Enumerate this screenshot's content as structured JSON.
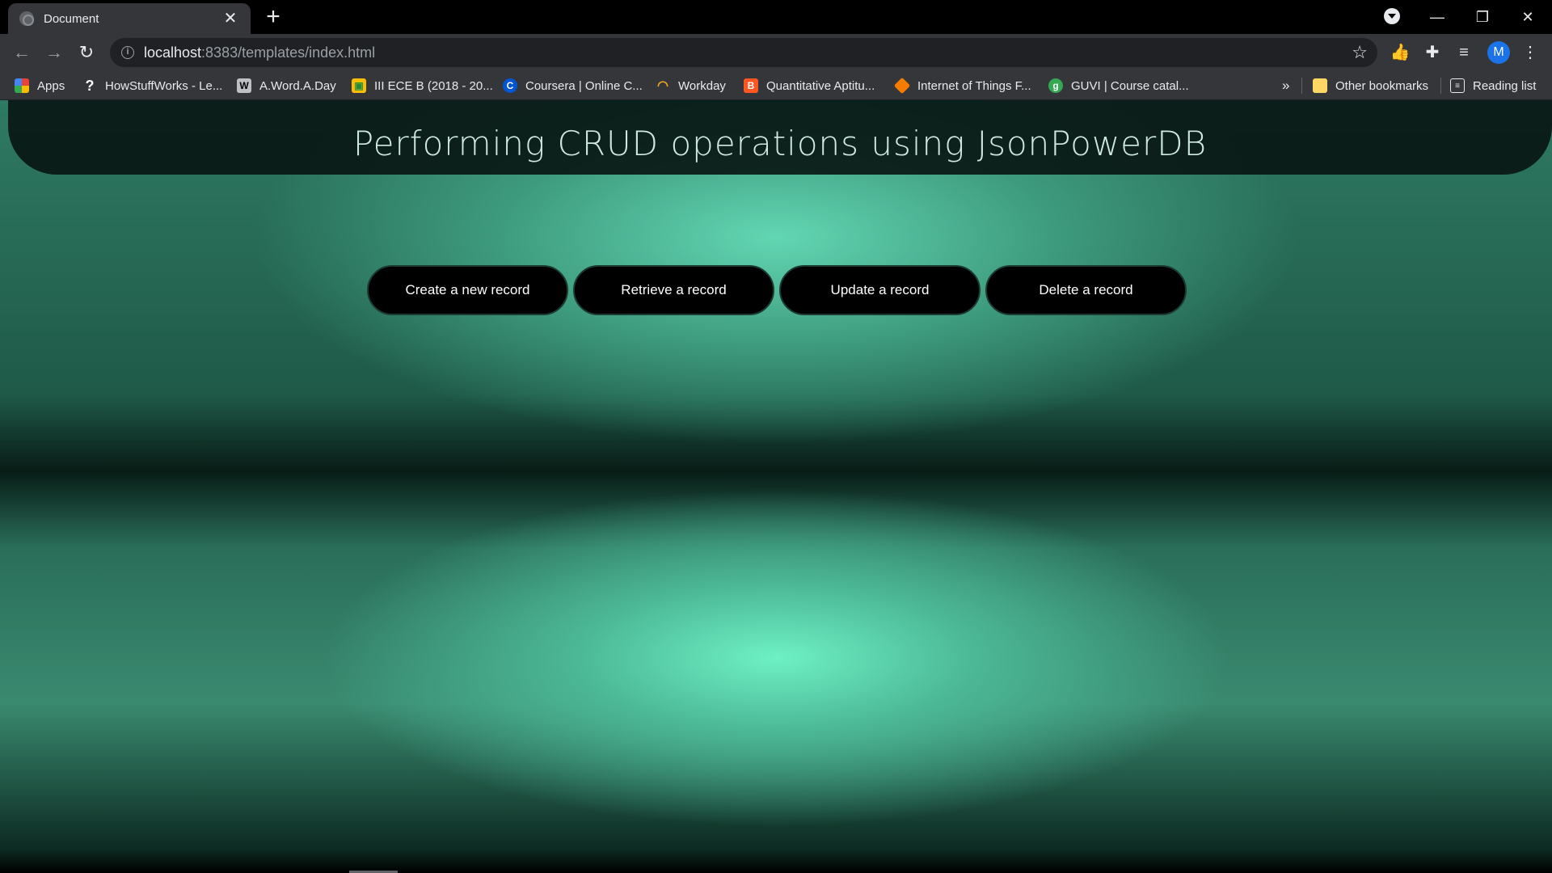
{
  "browser": {
    "tab_title": "Document",
    "url_host": "localhost",
    "url_path": ":8383/templates/index.html",
    "profile_initial": "M",
    "bookmarks": [
      {
        "label": "Apps",
        "icon": "apps-grid-icon",
        "color": "#ea4335"
      },
      {
        "label": "HowStuffWorks - Le...",
        "icon": "question-mark-icon",
        "color": "#ffffff"
      },
      {
        "label": "A.Word.A.Day",
        "icon": "awad-icon",
        "color": "#bdc1c6"
      },
      {
        "label": "III ECE B (2018 - 20...",
        "icon": "classroom-icon",
        "color": "#fbbc04"
      },
      {
        "label": "Coursera | Online C...",
        "icon": "coursera-icon",
        "color": "#0056d2"
      },
      {
        "label": "Workday",
        "icon": "workday-icon",
        "color": "#f5a623"
      },
      {
        "label": "Quantitative Aptitu...",
        "icon": "blogger-icon",
        "color": "#ff5722"
      },
      {
        "label": "Internet of Things F...",
        "icon": "iot-cube-icon",
        "color": "#f57c00"
      },
      {
        "label": "GUVI | Course catal...",
        "icon": "guvi-icon",
        "color": "#34a853"
      }
    ],
    "overflow_label": "»",
    "other_bookmarks": "Other bookmarks",
    "reading_list": "Reading list"
  },
  "page": {
    "title": "Performing CRUD operations using JsonPowerDB",
    "buttons": [
      {
        "label": "Create a new record"
      },
      {
        "label": "Retrieve a record"
      },
      {
        "label": "Update a record"
      },
      {
        "label": "Delete a record"
      }
    ]
  }
}
